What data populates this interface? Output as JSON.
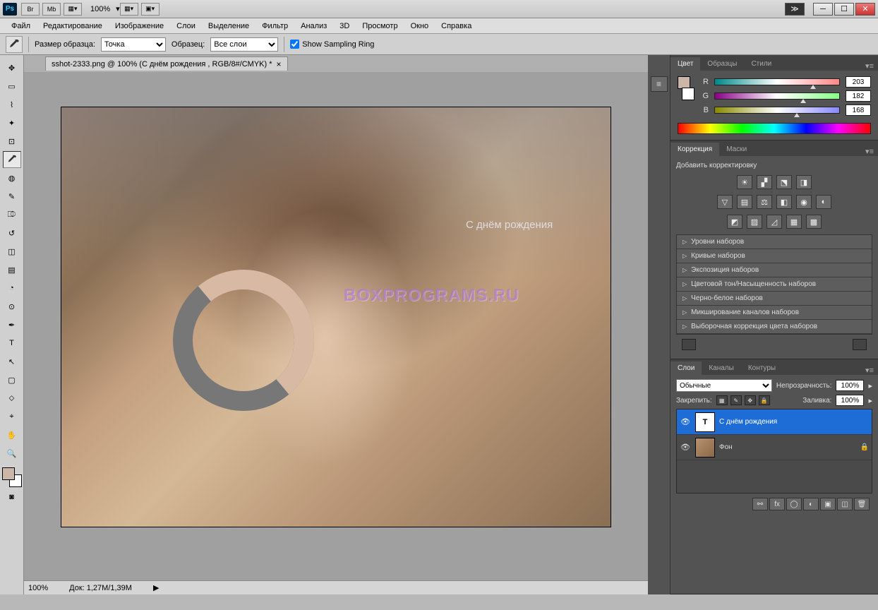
{
  "titlebar": {
    "ps": "Ps",
    "br": "Br",
    "mb": "Mb",
    "zoom": "100%"
  },
  "menu": [
    "Файл",
    "Редактирование",
    "Изображение",
    "Слои",
    "Выделение",
    "Фильтр",
    "Анализ",
    "3D",
    "Просмотр",
    "Окно",
    "Справка"
  ],
  "options": {
    "sample_size_label": "Размер образца:",
    "sample_size_value": "Точка",
    "sample_label": "Образец:",
    "sample_value": "Все слои",
    "ring_label": "Show Sampling Ring"
  },
  "document": {
    "tab": "sshot-2333.png @ 100% (С днём рождения , RGB/8#/CMYK) *"
  },
  "canvas": {
    "text": "С днём рождения",
    "watermark": "BOXPROGRAMS.RU"
  },
  "status": {
    "zoom": "100%",
    "doc": "Док: 1,27M/1,39M"
  },
  "color_panel": {
    "tabs": [
      "Цвет",
      "Образцы",
      "Стили"
    ],
    "r": "203",
    "g": "182",
    "b": "168",
    "swatch": "#CBB6A8"
  },
  "adjust_panel": {
    "tabs": [
      "Коррекция",
      "Маски"
    ],
    "add_label": "Добавить корректировку",
    "presets": [
      "Уровни наборов",
      "Кривые наборов",
      "Экспозиция наборов",
      "Цветовой тон/Насыщенность наборов",
      "Черно-белое наборов",
      "Микширование каналов наборов",
      "Выборочная коррекция цвета наборов"
    ]
  },
  "layers_panel": {
    "tabs": [
      "Слои",
      "Каналы",
      "Контуры"
    ],
    "blend_label": "Обычные",
    "opacity_label": "Непрозрачность:",
    "opacity_value": "100%",
    "lock_label": "Закрепить:",
    "fill_label": "Заливка:",
    "fill_value": "100%",
    "layers": [
      {
        "name": "С днём рождения",
        "type": "T",
        "selected": true,
        "locked": false
      },
      {
        "name": "Фон",
        "type": "img",
        "selected": false,
        "locked": true
      }
    ]
  }
}
